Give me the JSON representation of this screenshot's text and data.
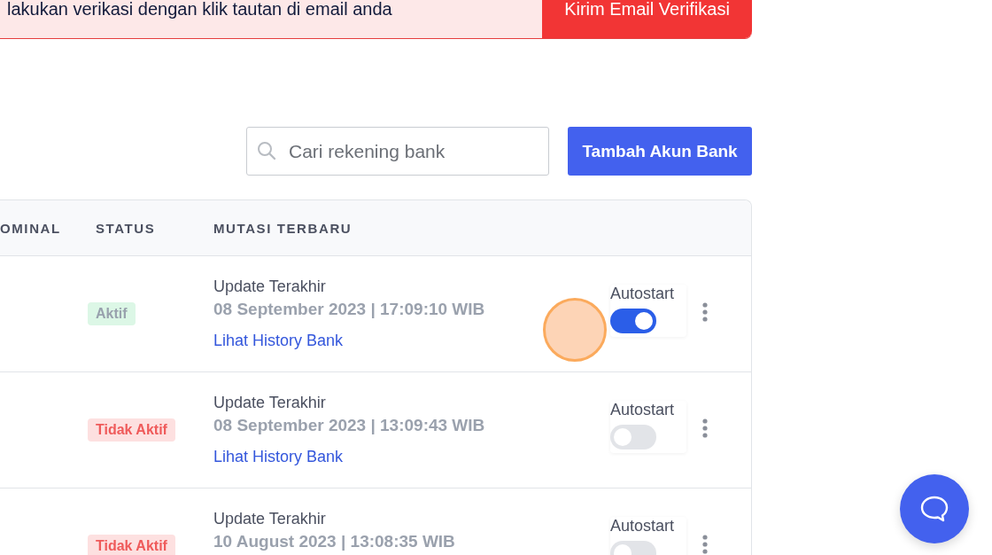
{
  "banner": {
    "message": "lakukan verikasi dengan klik tautan di email anda",
    "button": "Kirim Email Verifikasi"
  },
  "toolbar": {
    "search": {
      "placeholder": "Cari rekening bank"
    },
    "add_button": "Tambah Akun Bank"
  },
  "table": {
    "columns": [
      "OMINAL",
      "STATUS",
      "MUTASI TERBARU"
    ],
    "rows": [
      {
        "status": {
          "label": "Aktif",
          "kind": "active"
        },
        "update_label": "Update Terakhir",
        "timestamp": "08 September 2023 | 17:09:10 WIB",
        "link": "Lihat History Bank",
        "autostart_label": "Autostart",
        "autostart_on": true,
        "click_indicator": true
      },
      {
        "status": {
          "label": "Tidak Aktif",
          "kind": "inactive"
        },
        "update_label": "Update Terakhir",
        "timestamp": "08 September 2023 | 13:09:43 WIB",
        "link": "Lihat History Bank",
        "autostart_label": "Autostart",
        "autostart_on": false,
        "click_indicator": false
      },
      {
        "status": {
          "label": "Tidak Aktif",
          "kind": "inactive"
        },
        "update_label": "Update Terakhir",
        "timestamp": "10 August 2023 | 13:08:35 WIB",
        "autostart_label": "Autostart",
        "autostart_on": false,
        "click_indicator": false
      }
    ]
  }
}
